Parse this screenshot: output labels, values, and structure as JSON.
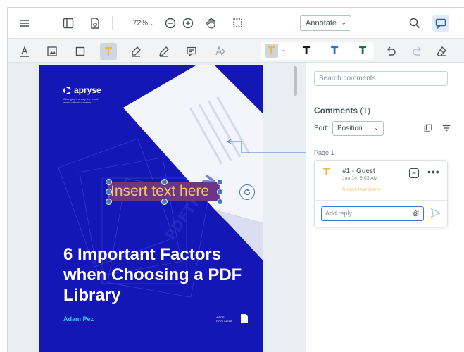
{
  "header": {
    "zoom_value": "72%",
    "zoom_chevron": "⌄",
    "mode": "Annotate",
    "mode_chevron": "⌄"
  },
  "document": {
    "brand": "apryse",
    "tagline": "Changing the way the world works with documents.",
    "title": "6 Important Factors when Choosing a PDF Library",
    "author": "Adam Pez",
    "doc_tag": "A PDF DOCUMENT",
    "annotation_text": "Insert text here",
    "colors": {
      "page": "#1416b5",
      "annotation_fill": "#6c3588",
      "annotation_text": "#f5c56b",
      "selection": "#3f79c7"
    }
  },
  "panel": {
    "search_placeholder": "Search comments",
    "comments_label": "Comments",
    "comments_count": "(1)",
    "sort_label": "Sort:",
    "sort_value": "Position",
    "page_label": "Page 1",
    "comment": {
      "number_author": "#1 - Guest",
      "timestamp": "Jun 14, 9:03 AM",
      "text": "Insert text here",
      "icon_glyph": "T"
    },
    "reply_placeholder": "Add reply..."
  },
  "toolbar_style": {
    "glyph": "T",
    "colors": [
      "#1a1a1a",
      "#2f6fd1",
      "#18763f"
    ]
  }
}
